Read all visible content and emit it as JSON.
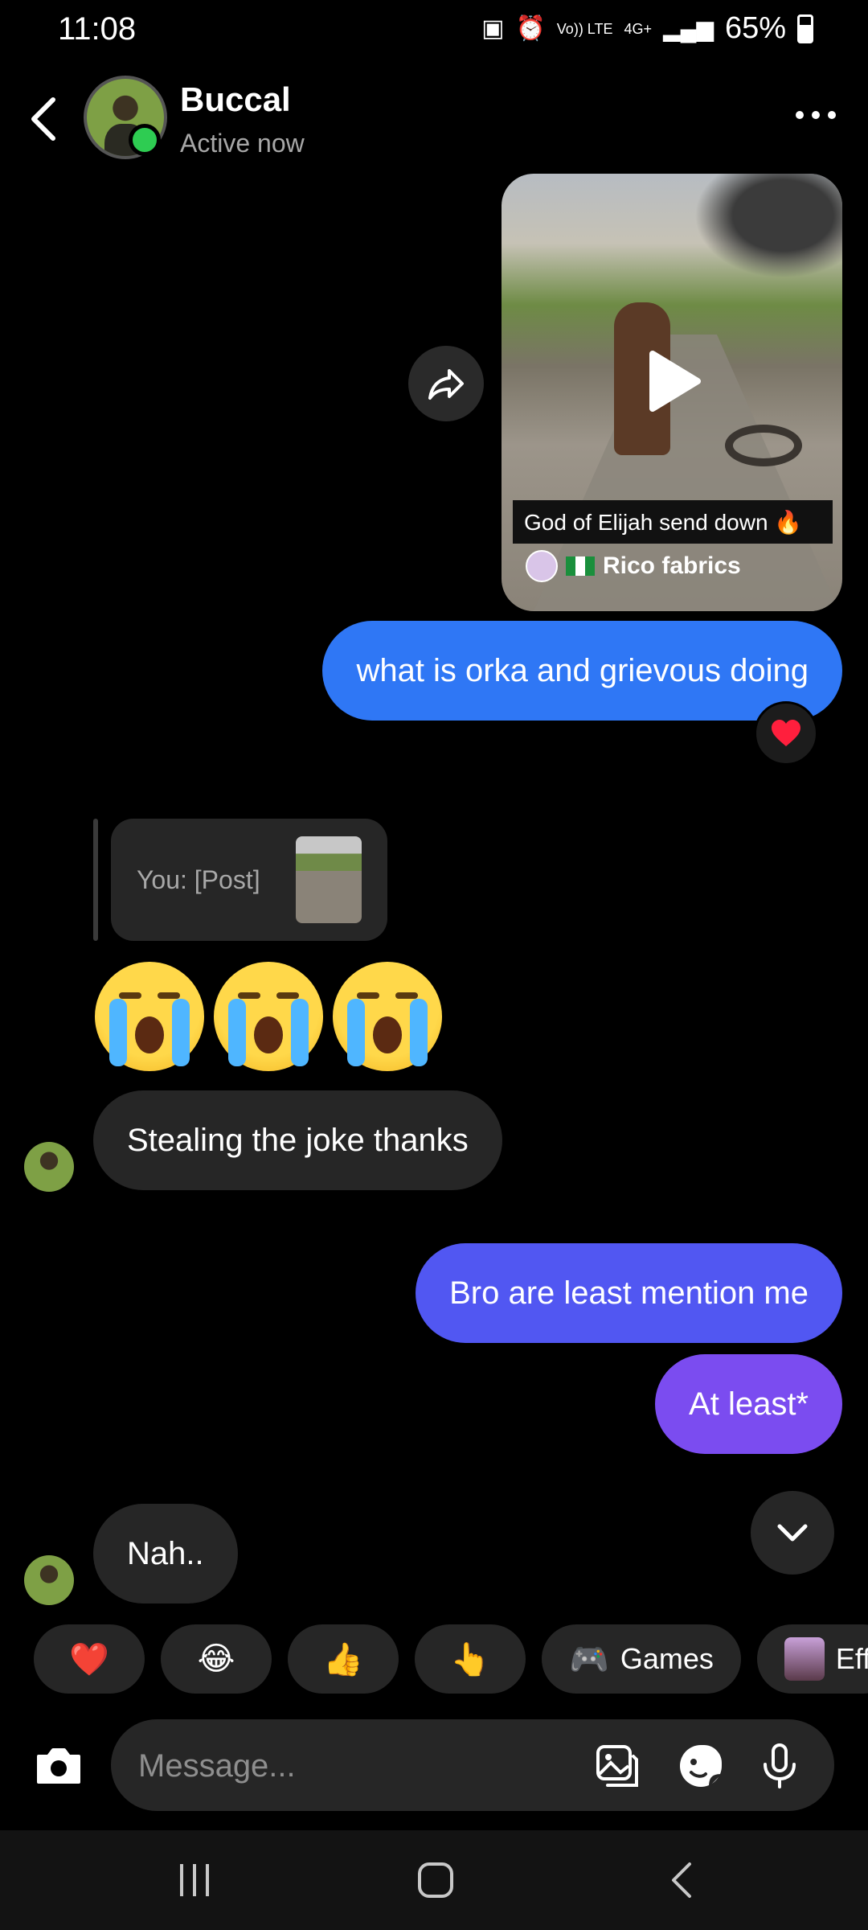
{
  "status_bar": {
    "time": "11:08",
    "volte": "Vo)) LTE",
    "network": "4G+",
    "battery": "65%"
  },
  "header": {
    "name": "Buccal",
    "status": "Active now"
  },
  "shared_post": {
    "caption": "God of Elijah send down 🔥",
    "author": "Rico fabrics"
  },
  "messages": {
    "out1": "what is orka and grievous doing",
    "reply_preview": "You: [Post]",
    "emojis": [
      "😭",
      "😭",
      "😭"
    ],
    "in1": "Stealing the joke thanks",
    "out2": "Bro are least mention me",
    "out3": "At least*",
    "in2": "Nah.."
  },
  "reaction": "❤️",
  "quick_replies": [
    {
      "icon": "❤️"
    },
    {
      "icon": "😂"
    },
    {
      "icon": "👍"
    },
    {
      "icon": "👆"
    },
    {
      "icon": "🎮",
      "label": "Games"
    },
    {
      "label": "Eff"
    }
  ],
  "composer": {
    "placeholder": "Message..."
  },
  "colors": {
    "out_blue": "#2f77f5",
    "out_indigo": "#5157f2",
    "out_violet": "#7b4cf0",
    "in_gray": "#262626",
    "online": "#2ecc52"
  }
}
